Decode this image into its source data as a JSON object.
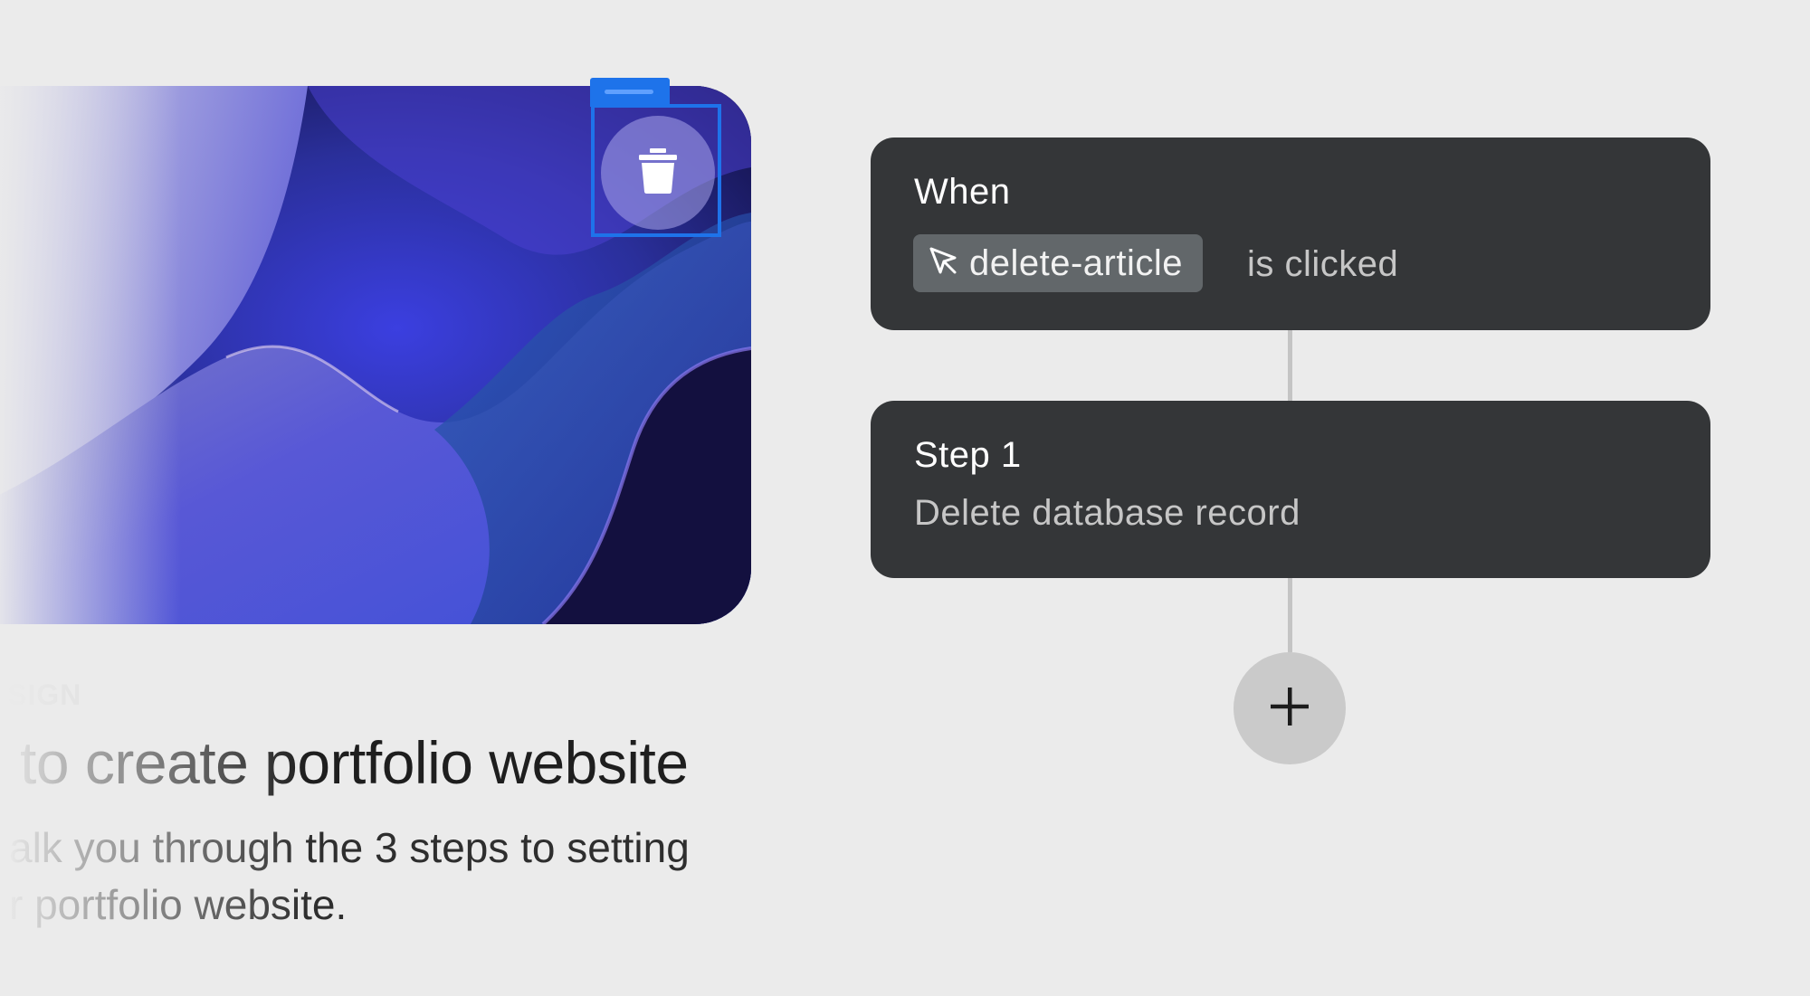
{
  "card": {
    "label": "SIGN",
    "title": "to create portfolio website",
    "description_line1": "alk you through the 3 steps to setting",
    "description_line2": "r portfolio website.",
    "trash_icon": "trash-icon"
  },
  "workflow": {
    "trigger": {
      "heading": "When",
      "element_icon": "cursor-arrow-icon",
      "element_name": "delete-article",
      "event_text": "is clicked"
    },
    "steps": [
      {
        "heading": "Step 1",
        "action": "Delete database record"
      }
    ],
    "add_icon": "plus-icon"
  },
  "colors": {
    "background": "#ebebeb",
    "card_dark": "#343638",
    "chip": "#62676a",
    "selection_blue": "#1e73ea",
    "add_button": "#cacaca"
  }
}
